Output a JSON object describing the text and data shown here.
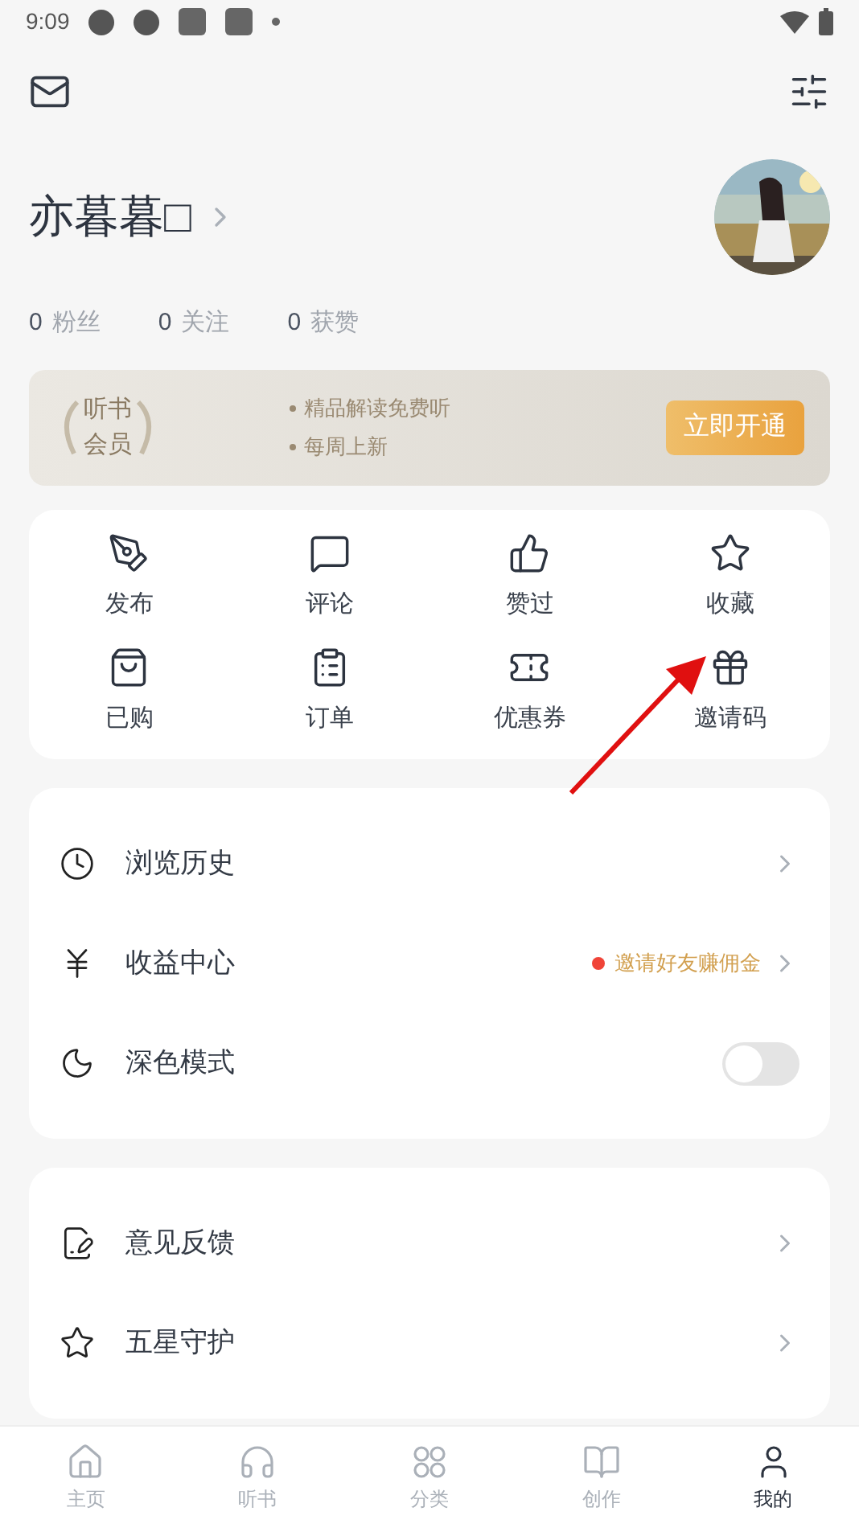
{
  "status_bar": {
    "time": "9:09"
  },
  "profile": {
    "name": "亦暮暮□",
    "stats": [
      {
        "count": "0",
        "label": "粉丝"
      },
      {
        "count": "0",
        "label": "关注"
      },
      {
        "count": "0",
        "label": "获赞"
      }
    ]
  },
  "vip_banner": {
    "badge_lines": [
      "听书",
      "会员"
    ],
    "perks": [
      "精品解读免费听",
      "每周上新"
    ],
    "button": "立即开通"
  },
  "shortcuts": [
    {
      "label": "发布"
    },
    {
      "label": "评论"
    },
    {
      "label": "赞过"
    },
    {
      "label": "收藏"
    },
    {
      "label": "已购"
    },
    {
      "label": "订单"
    },
    {
      "label": "优惠券"
    },
    {
      "label": "邀请码"
    }
  ],
  "menu_groups": [
    [
      {
        "kind": "link",
        "label": "浏览历史"
      },
      {
        "kind": "link",
        "label": "收益中心",
        "note": "邀请好友赚佣金",
        "color": "#f04438"
      },
      {
        "kind": "toggle",
        "label": "深色模式",
        "on": false
      }
    ],
    [
      {
        "kind": "link",
        "label": "意见反馈"
      },
      {
        "kind": "link",
        "label": "五星守护"
      }
    ]
  ],
  "bottom_nav": [
    {
      "label": "主页",
      "selected": false
    },
    {
      "label": "听书",
      "selected": false
    },
    {
      "label": "分类",
      "selected": false
    },
    {
      "label": "创作",
      "selected": false
    },
    {
      "label": "我的",
      "selected": true
    }
  ]
}
